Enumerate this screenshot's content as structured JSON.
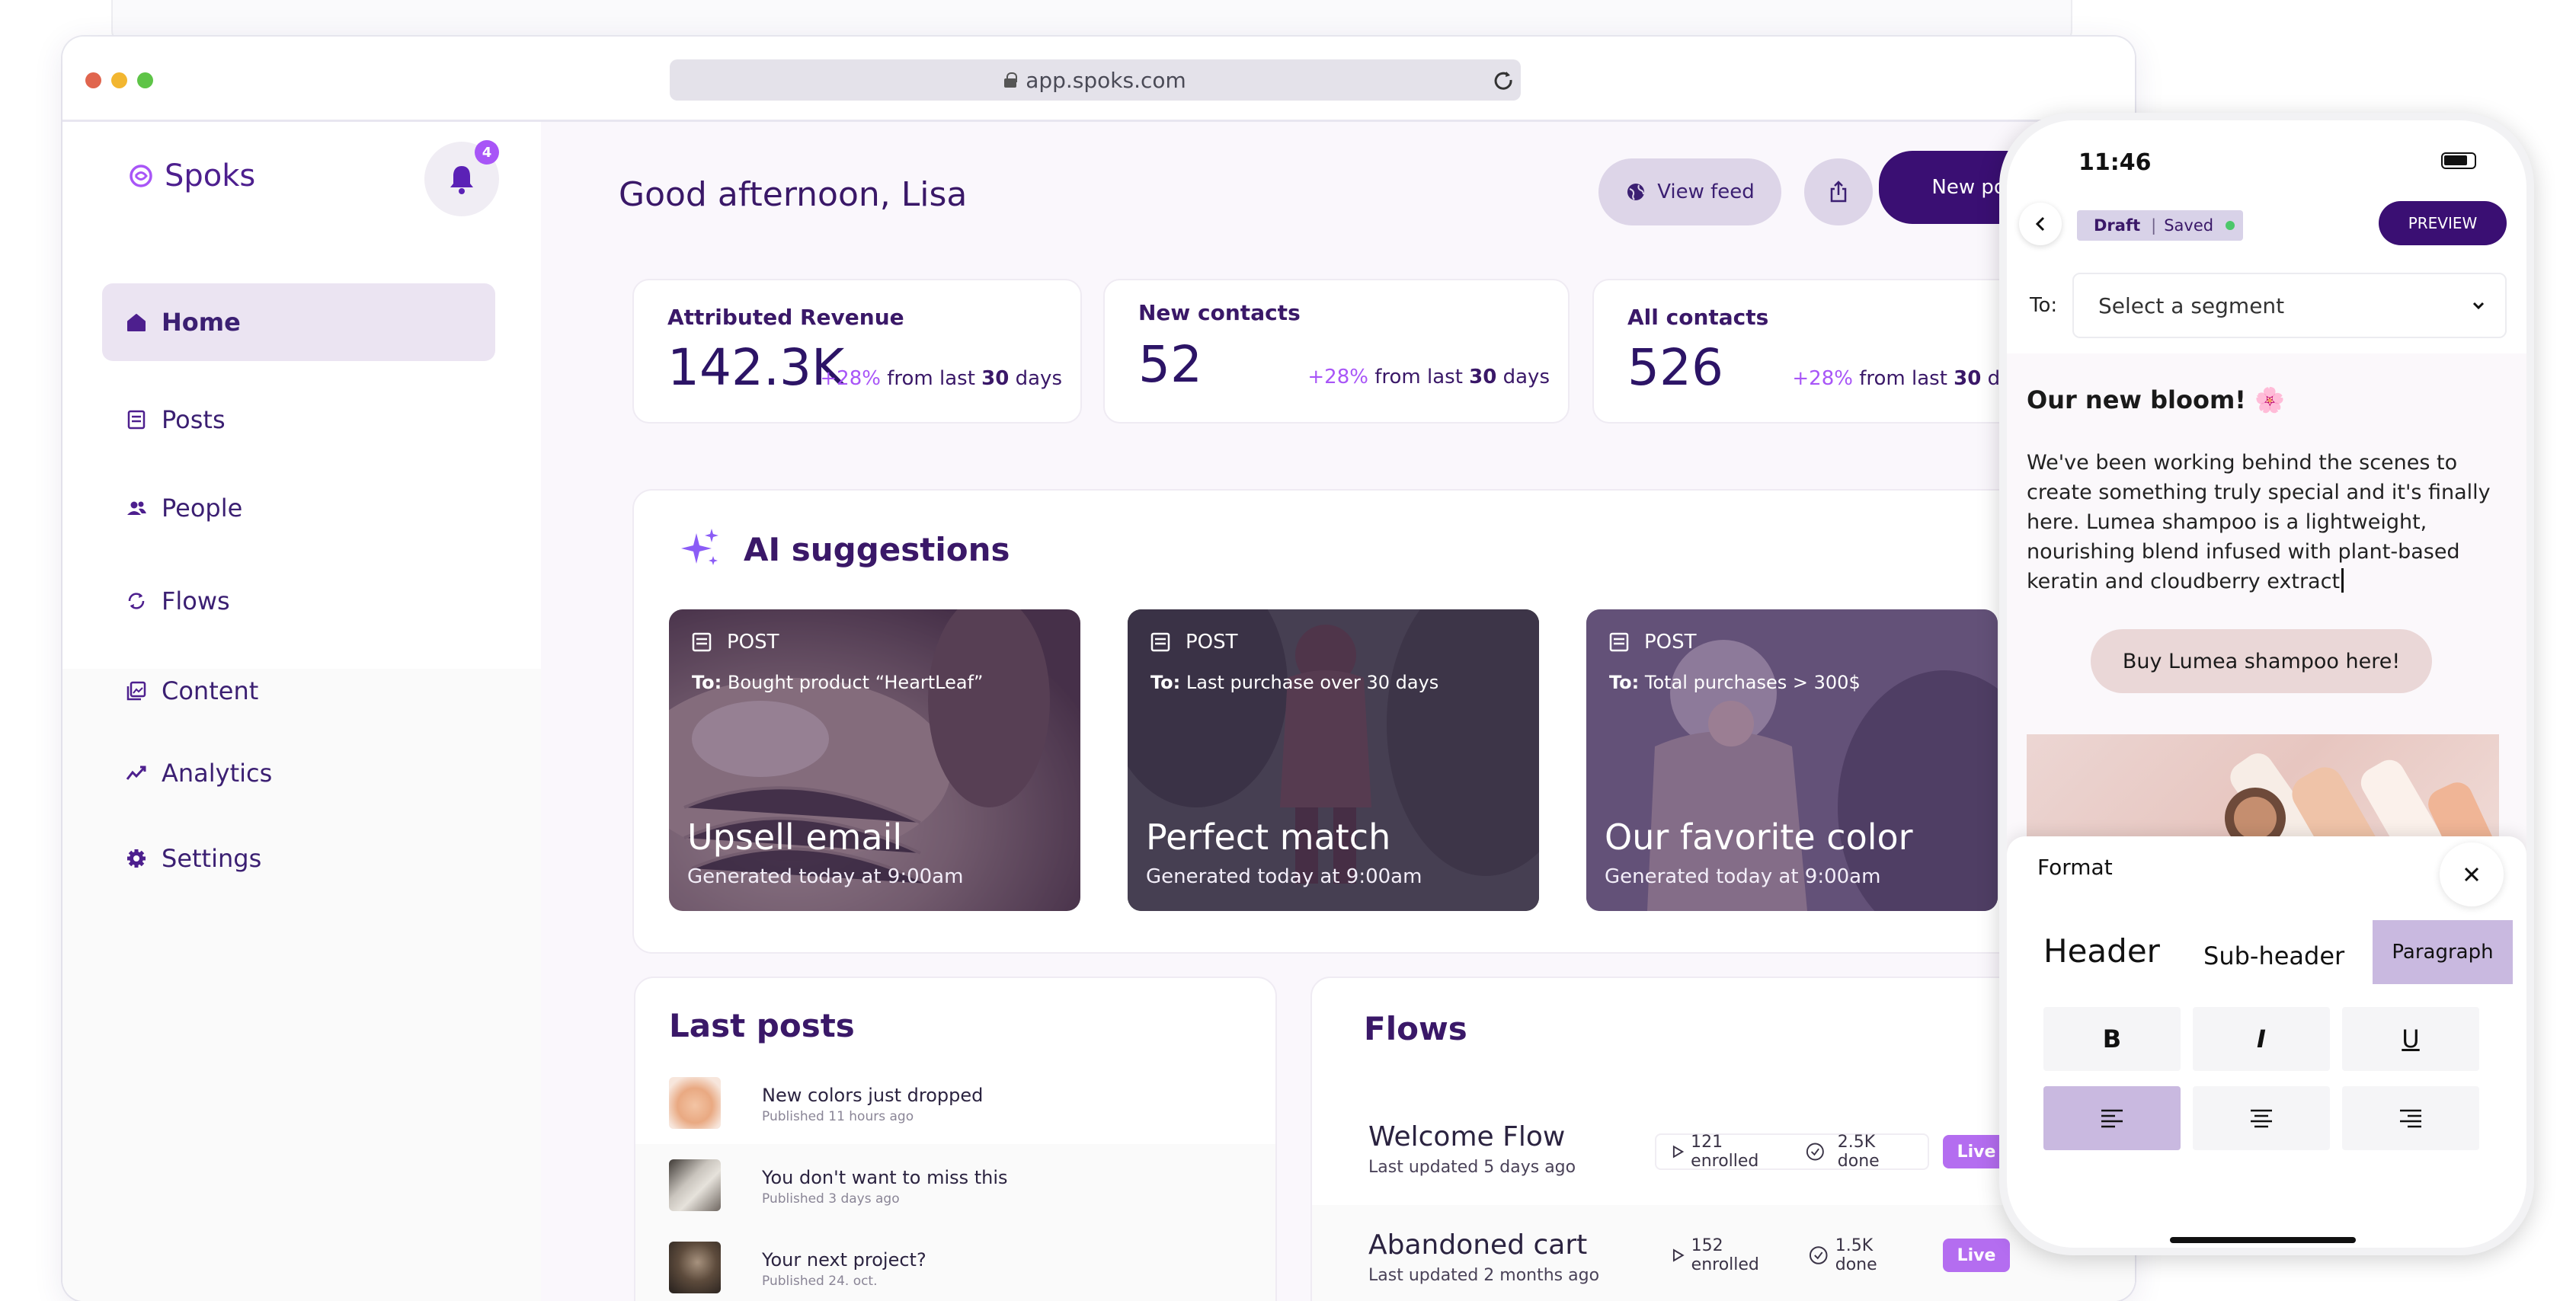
{
  "browser": {
    "url": "app.spoks.com"
  },
  "sidebar": {
    "logo": "Spoks",
    "notifications": "4",
    "items": [
      {
        "label": "Home"
      },
      {
        "label": "Posts"
      },
      {
        "label": "People"
      },
      {
        "label": "Flows"
      },
      {
        "label": "Content"
      },
      {
        "label": "Analytics"
      },
      {
        "label": "Settings"
      }
    ]
  },
  "header": {
    "greeting": "Good afternoon, Lisa",
    "view_feed": "View feed",
    "new_post": "New post"
  },
  "stats": [
    {
      "label": "Attributed Revenue",
      "value": "142.3K",
      "pct": "+28%",
      "from": " from last ",
      "days": "30",
      "unit": " days"
    },
    {
      "label": "New contacts",
      "value": "52",
      "pct": "+28%",
      "from": " from last ",
      "days": "30",
      "unit": " days"
    },
    {
      "label": "All contacts",
      "value": "526",
      "pct": "+28%",
      "from": " from last ",
      "days": "30",
      "unit": " days"
    }
  ],
  "ai": {
    "title": "AI suggestions",
    "cards": [
      {
        "type": "POST",
        "to_label": "To:",
        "to": " Bought product “HeartLeaf”",
        "title": "Upsell email",
        "generated": "Generated today at 9:00am"
      },
      {
        "type": "POST",
        "to_label": "To:",
        "to": " Last purchase over 30 days",
        "title": "Perfect match",
        "generated": "Generated today at 9:00am"
      },
      {
        "type": "POST",
        "to_label": "To:",
        "to": " Total purchases > 300$",
        "title": "Our favorite color",
        "generated": "Generated today at 9:00am"
      }
    ]
  },
  "last_posts": {
    "title": "Last posts",
    "items": [
      {
        "title": "New colors just dropped",
        "sub": "Published 11 hours ago"
      },
      {
        "title": "You don't want to miss this",
        "sub": "Published 3 days ago"
      },
      {
        "title": "Your next project?",
        "sub": "Published 24. oct."
      }
    ]
  },
  "flows": {
    "title": "Flows",
    "items": [
      {
        "name": "Welcome Flow",
        "updated": "Last updated 5 days ago",
        "enrolled": "121 enrolled",
        "done": "2.5K done",
        "status": "Live"
      },
      {
        "name": "Abandoned cart",
        "updated": "Last updated 2 months ago",
        "enrolled": "152 enrolled",
        "done": "1.5K done",
        "status": "Live"
      }
    ]
  },
  "phone": {
    "time": "11:46",
    "draft": "Draft",
    "saved": "Saved",
    "preview": "PREVIEW",
    "to_label": "To:",
    "segment_placeholder": "Select a segment",
    "headline": "Our new bloom! 🌸",
    "body": "We've been working behind the scenes to create something truly special and it's finally here. Lumea shampoo is a lightweight, nourishing blend infused with plant-based keratin and cloudberry extract",
    "cta": "Buy Lumea shampoo here!",
    "format": {
      "title": "Format",
      "header": "Header",
      "subheader": "Sub-header",
      "paragraph": "Paragraph",
      "bold": "B",
      "italic": "I",
      "underline": "U"
    }
  },
  "colors": {
    "brand_dark": "#3a0f73",
    "accent": "#a855f7",
    "live": "#b46df0",
    "active_nav": "#ebe4f2"
  }
}
